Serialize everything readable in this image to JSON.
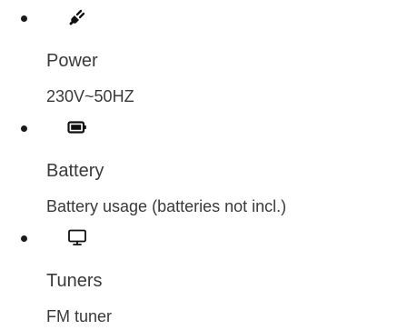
{
  "specs": [
    {
      "icon": "power-plug-icon",
      "title": "Power",
      "value": "230V~50HZ"
    },
    {
      "icon": "battery-icon",
      "title": "Battery",
      "value": "Battery usage (batteries not incl.)"
    },
    {
      "icon": "monitor-icon",
      "title": "Tuners",
      "value": "FM tuner"
    }
  ],
  "colors": {
    "text": "#3a3a3a",
    "icon": "#111111",
    "bullet": "#1a1a1a",
    "background": "#ffffff"
  }
}
